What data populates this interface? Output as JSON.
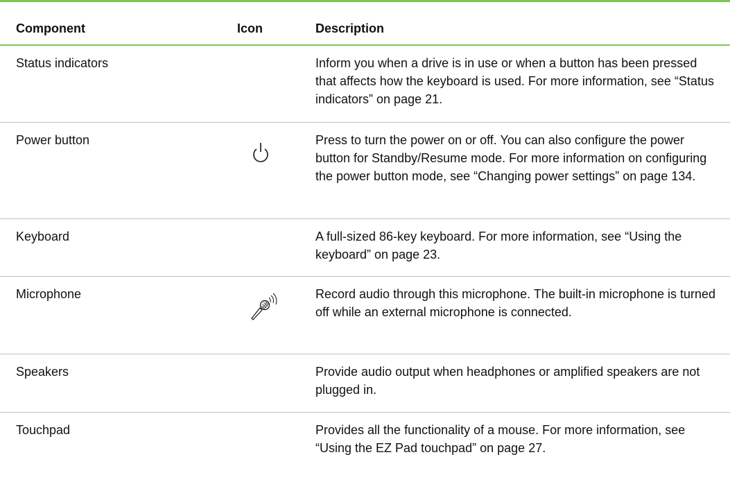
{
  "table": {
    "headers": {
      "component": "Component",
      "icon": "Icon",
      "description": "Description"
    },
    "rows": [
      {
        "component": "Status indicators",
        "icon": "",
        "description": "Inform you when a drive is in use or when a button has been pressed that affects how the keyboard is used. For more information, see “Status indicators” on page 21."
      },
      {
        "component": "Power button",
        "icon": "power-icon",
        "description": "Press to turn the power on or off. You can also configure the power button for Standby/Resume mode. For more information on configuring the power button mode, see “Changing power settings” on page 134."
      },
      {
        "component": "Keyboard",
        "icon": "",
        "description": "A full-sized 86-key keyboard. For more information, see “Using the keyboard” on page 23."
      },
      {
        "component": "Microphone",
        "icon": "microphone-icon",
        "description": "Record audio through this microphone. The built-in microphone is turned off while an external microphone is connected."
      },
      {
        "component": "Speakers",
        "icon": "",
        "description": "Provide audio output when headphones or amplified speakers are not plugged in."
      },
      {
        "component": "Touchpad",
        "icon": "",
        "description": "Provides all the functionality of a mouse. For more information, see “Using the EZ Pad touchpad” on page 27."
      }
    ]
  },
  "colors": {
    "rule_accent": "#79c84f",
    "row_divider": "#bfbfbf",
    "text": "#111111"
  }
}
